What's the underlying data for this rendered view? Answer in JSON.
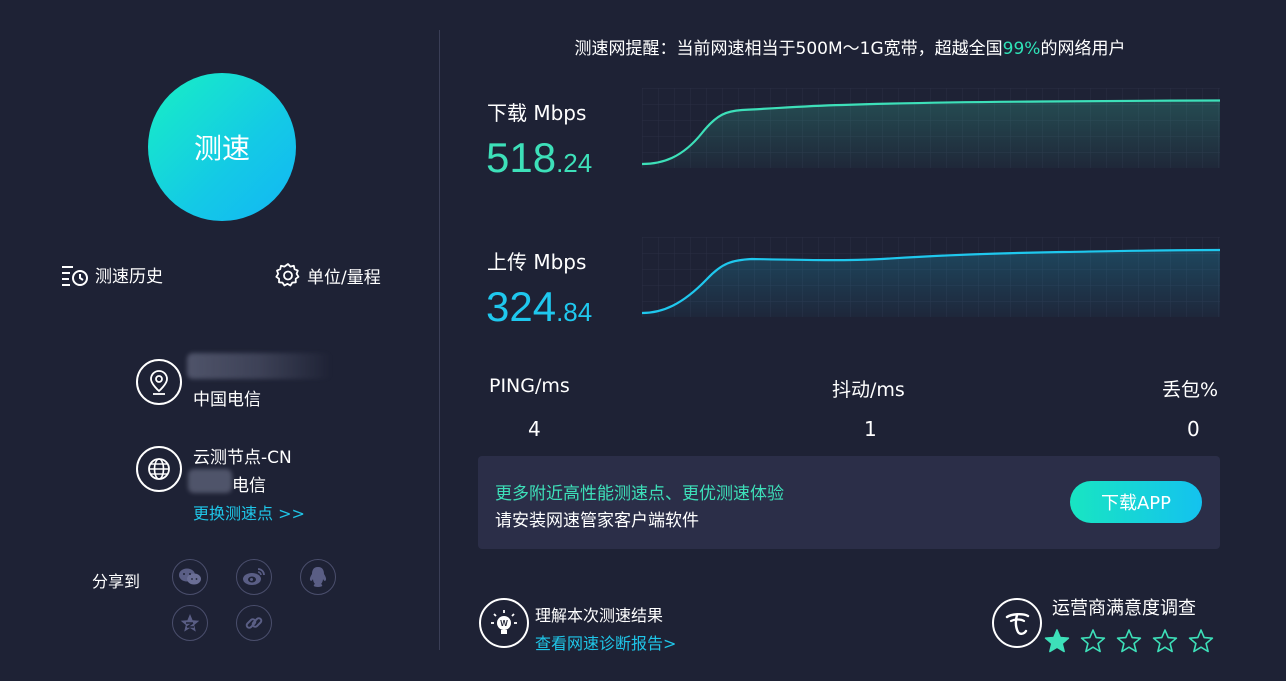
{
  "left": {
    "start_button": "测速",
    "history_label": "测速历史",
    "units_label": "单位/量程",
    "isp_name": "中国电信",
    "node_title": "云测节点-CN",
    "node_isp_suffix": "电信",
    "change_node_link": "更换测速点 >>",
    "share_label": "分享到",
    "share_icons": [
      "wechat-icon",
      "weibo-icon",
      "qq-icon",
      "qzone-icon",
      "link-icon"
    ]
  },
  "tip": {
    "prefix": "测速网提醒：当前网速相当于500M～1G宽带，超越全国",
    "percent": "99%",
    "suffix": "的网络用户"
  },
  "download": {
    "label": "下载 Mbps",
    "value_int": "518",
    "value_dec": ".24",
    "color": "#3de0b9"
  },
  "upload": {
    "label": "上传 Mbps",
    "value_int": "324",
    "value_dec": ".84",
    "color": "#1fc8ee"
  },
  "stats": {
    "ping_label": "PING/ms",
    "ping_value": "4",
    "jitter_label": "抖动/ms",
    "jitter_value": "1",
    "loss_label": "丢包%",
    "loss_value": "0"
  },
  "promo": {
    "line1": "更多附近高性能测速点、更优测速体验",
    "line2": "请安装网速管家客户端软件",
    "button": "下载APP"
  },
  "report": {
    "title": "理解本次测速结果",
    "link": "查看网速诊断报告>"
  },
  "survey": {
    "title": "运营商满意度调查",
    "rating": 1,
    "max_rating": 5
  }
}
